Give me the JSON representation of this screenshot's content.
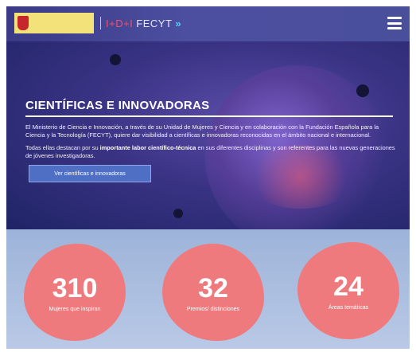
{
  "header": {
    "brand_primary": "#3a3a86",
    "fecyt_prefix": "I+D+I",
    "fecyt_name": "FECYT",
    "fecyt_chevron": "»",
    "menu_icon": "hamburger-icon"
  },
  "hero": {
    "title": "CIENTÍFICAS E INNOVADORAS",
    "paragraph1": "El Ministerio de Ciencia e Innovación, a través de su Unidad de Mujeres y Ciencia y en colaboración con la Fundación Española para la Ciencia y la Tecnología (FECYT), quiere dar visibilidad a científicas e innovadoras reconocidas en el ámbito nacional e internacional.",
    "paragraph2_start": "Todas ellas destacan por su ",
    "paragraph2_bold": "importante labor científico-técnica",
    "paragraph2_end": " en sus diferentes disciplinas y son referentes para las nuevas generaciones de jóvenes investigadoras.",
    "button_label": "Ver científicas e innovadoras"
  },
  "stats": [
    {
      "number": "310",
      "label": "Mujeres que inspiran"
    },
    {
      "number": "32",
      "label": "Premios/ distinciones"
    },
    {
      "number": "24",
      "label": "Áreas temáticas"
    }
  ],
  "colors": {
    "stat_bubble": "#ef7a7e",
    "stats_background": "#9db3d9",
    "button": "#4e6fc4"
  }
}
